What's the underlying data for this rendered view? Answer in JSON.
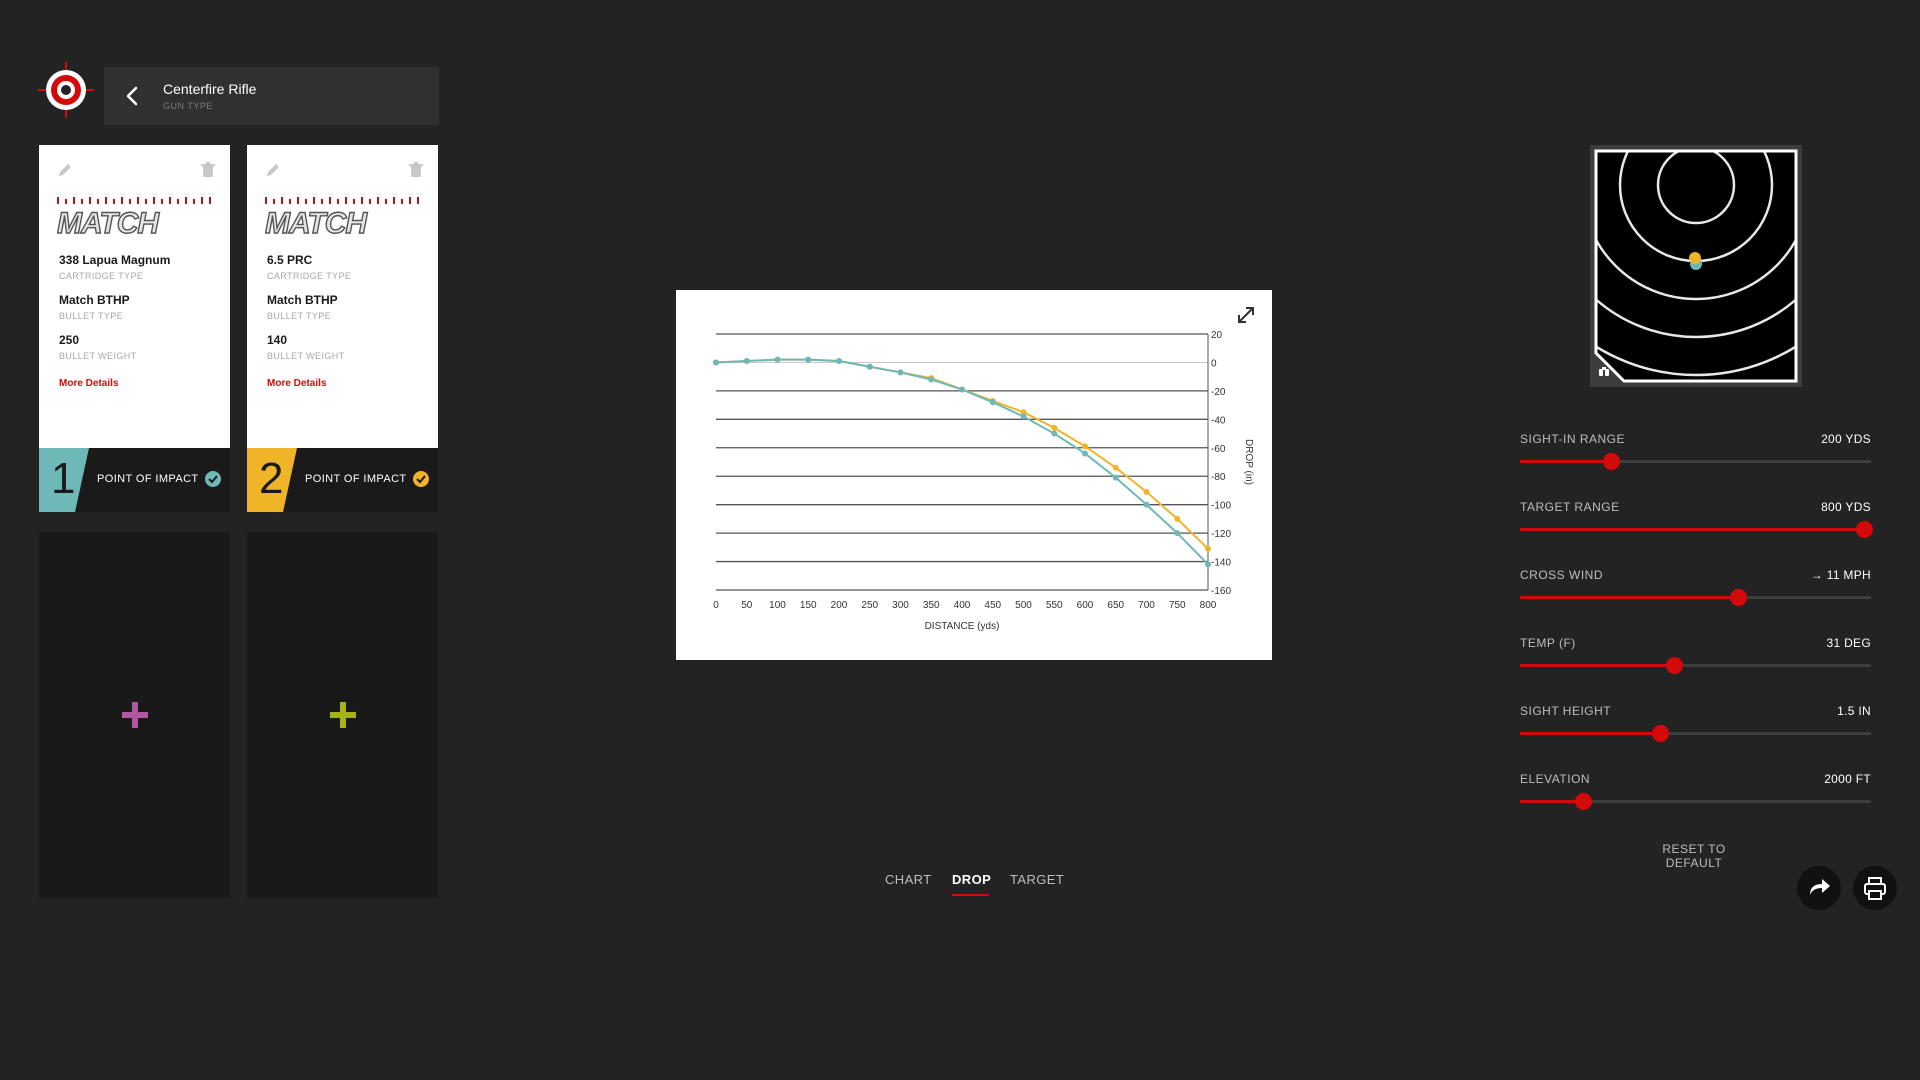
{
  "header": {
    "title": "Centerfire Rifle",
    "subtitle": "GUN TYPE"
  },
  "cards": [
    {
      "brand": "MATCH",
      "cartridge": "338 Lapua Magnum",
      "cartridge_label": "CARTRIDGE TYPE",
      "bullet": "Match BTHP",
      "bullet_label": "BULLET TYPE",
      "weight": "250",
      "weight_label": "BULLET WEIGHT",
      "more": "More Details",
      "number": "1",
      "poi_label": "POINT OF IMPACT",
      "color": "#6fb8b8"
    },
    {
      "brand": "MATCH",
      "cartridge": "6.5 PRC",
      "cartridge_label": "CARTRIDGE TYPE",
      "bullet": "Match BTHP",
      "bullet_label": "BULLET TYPE",
      "weight": "140",
      "weight_label": "BULLET WEIGHT",
      "more": "More Details",
      "number": "2",
      "poi_label": "POINT OF IMPACT",
      "color": "#f0b429"
    }
  ],
  "add_slots": [
    {
      "color": "#b0589f"
    },
    {
      "color": "#a3b318"
    }
  ],
  "chart_data": {
    "type": "line",
    "xlabel": "DISTANCE (yds)",
    "ylabel": "DROP (in)",
    "xlim": [
      0,
      800
    ],
    "ylim": [
      -160,
      20
    ],
    "x_ticks": [
      0,
      50,
      100,
      150,
      200,
      250,
      300,
      350,
      400,
      450,
      500,
      550,
      600,
      650,
      700,
      750,
      800
    ],
    "y_ticks": [
      20,
      0,
      -20,
      -40,
      -60,
      -80,
      -100,
      -120,
      -140,
      -160
    ],
    "y_tick_labels": [
      "20",
      "0",
      "-20",
      "-40",
      "-60",
      "-80",
      "-100",
      "-120",
      "-140",
      "-160"
    ],
    "grid": true,
    "series": [
      {
        "color": "#f0b429",
        "x": [
          0,
          50,
          100,
          150,
          200,
          250,
          300,
          350,
          400,
          450,
          500,
          550,
          600,
          650,
          700,
          750,
          800
        ],
        "y": [
          0,
          1,
          2,
          2,
          1,
          -3,
          -7,
          -11,
          -19,
          -27,
          -35,
          -46,
          -59,
          -74,
          -91,
          -110,
          -131
        ]
      },
      {
        "color": "#6fb8b8",
        "x": [
          0,
          50,
          100,
          150,
          200,
          250,
          300,
          350,
          400,
          450,
          500,
          550,
          600,
          650,
          700,
          750,
          800
        ],
        "y": [
          0,
          1,
          2,
          2,
          1,
          -3,
          -7,
          -12,
          -19,
          -28,
          -38,
          -50,
          -64,
          -81,
          -100,
          -120,
          -142
        ]
      }
    ]
  },
  "tabs": [
    {
      "label": "CHART",
      "active": false
    },
    {
      "label": "DROP",
      "active": true
    },
    {
      "label": "TARGET",
      "active": false
    }
  ],
  "sliders": [
    {
      "label": "SIGHT-IN RANGE",
      "value": "200 YDS",
      "fraction": 0.26
    },
    {
      "label": "TARGET RANGE",
      "value": "800 YDS",
      "fraction": 0.98
    },
    {
      "label": "CROSS WIND",
      "value": "→ 11 MPH",
      "fraction": 0.62
    },
    {
      "label": "TEMP (F)",
      "value": "31 DEG",
      "fraction": 0.44
    },
    {
      "label": "SIGHT HEIGHT",
      "value": "1.5 IN",
      "fraction": 0.4
    },
    {
      "label": "ELEVATION",
      "value": "2000 FT",
      "fraction": 0.18
    }
  ],
  "reset_label": "RESET TO DEFAULT",
  "icons": {
    "logo": "crosshair-target-logo",
    "back": "chevron-left-icon",
    "edit": "pencil-icon",
    "delete": "trash-icon",
    "check": "check-circle-icon",
    "add": "plus-icon",
    "expand": "expand-arrows-icon",
    "binoculars": "binoculars-icon",
    "share": "share-arrow-icon",
    "print": "printer-icon"
  },
  "accent_color": "#d40a0a"
}
